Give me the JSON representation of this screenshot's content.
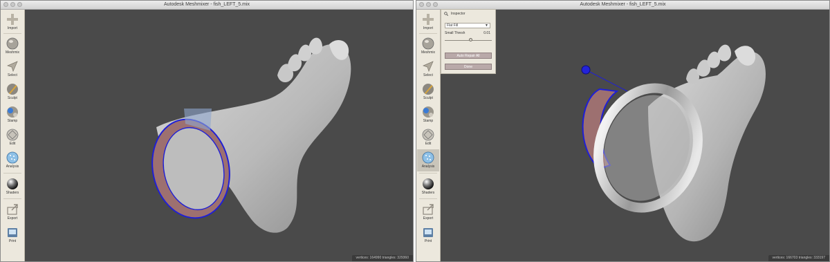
{
  "window_title": "Autodesk Meshmixer - fish_LEFT_5.mix",
  "tools": [
    {
      "name": "import",
      "label": "Import",
      "icon": "plus-icon"
    },
    {
      "name": "meshmix",
      "label": "Meshmix",
      "icon": "meshmix-sphere-icon"
    },
    {
      "name": "select",
      "label": "Select",
      "icon": "cursor-arrow-icon"
    },
    {
      "name": "sculpt",
      "label": "Sculpt",
      "icon": "brush-icon"
    },
    {
      "name": "stamp",
      "label": "Stamp",
      "icon": "stamp-icon"
    },
    {
      "name": "edit",
      "label": "Edit",
      "icon": "edit-sphere-icon"
    },
    {
      "name": "analysis",
      "label": "Analysis",
      "icon": "analysis-sphere-icon"
    },
    {
      "name": "shaders",
      "label": "Shaders",
      "icon": "shader-sphere-icon"
    },
    {
      "name": "export",
      "label": "Export",
      "icon": "export-arrow-icon"
    },
    {
      "name": "print",
      "label": "Print",
      "icon": "printer-icon"
    }
  ],
  "left_status": "vertices: 164990 triangles: 329360",
  "right_status": "vertices: 166703 triangles: 333197",
  "inspector": {
    "title": "Inspector",
    "mode_select": "Flat Fill",
    "small_thresh_label": "Small Thresh",
    "small_thresh_value": "0.01",
    "auto_repair_label": "Auto Repair All",
    "done_label": "Done"
  },
  "colors": {
    "viewport_bg": "#4a4a4a",
    "toolbar_bg": "#ece8dd",
    "boundary_blue": "#1f1fd6",
    "defect_fill": "#9d7070"
  }
}
